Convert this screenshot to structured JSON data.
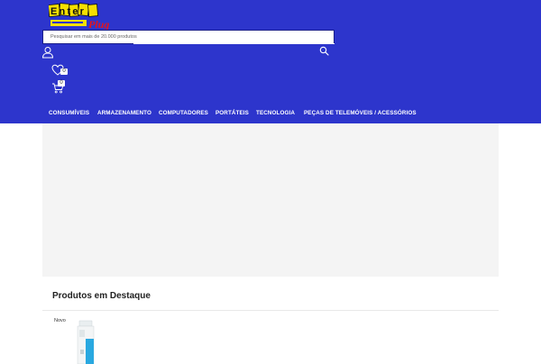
{
  "header": {
    "logo": {
      "text_line1": "Enter",
      "text_line2": "Plug",
      "name": "logo"
    },
    "search": {
      "placeholder": "Pesquisar em mais de 20.000 produtos"
    },
    "wishlist": {
      "count": "0"
    },
    "cart": {
      "count": "0"
    }
  },
  "nav": {
    "items": [
      {
        "label": "CONSUMÍVEIS"
      },
      {
        "label": "ARMAZENAMENTO"
      },
      {
        "label": "COMPUTADORES"
      },
      {
        "label": "PORTÁTEIS"
      },
      {
        "label": "TECNOLOGIA"
      },
      {
        "label": "PEÇAS DE TELEMÓVEIS / ACESSÓRIOS"
      }
    ]
  },
  "featured": {
    "title": "Produtos em Destaque",
    "products": [
      {
        "badge": "Novo"
      }
    ]
  },
  "colors": {
    "header_bg": "#2d35cc",
    "banner_bg": "#f4f4f4",
    "logo_yellow": "#f6e000",
    "logo_red": "#e3141c",
    "product_blue": "#29a8e0"
  }
}
